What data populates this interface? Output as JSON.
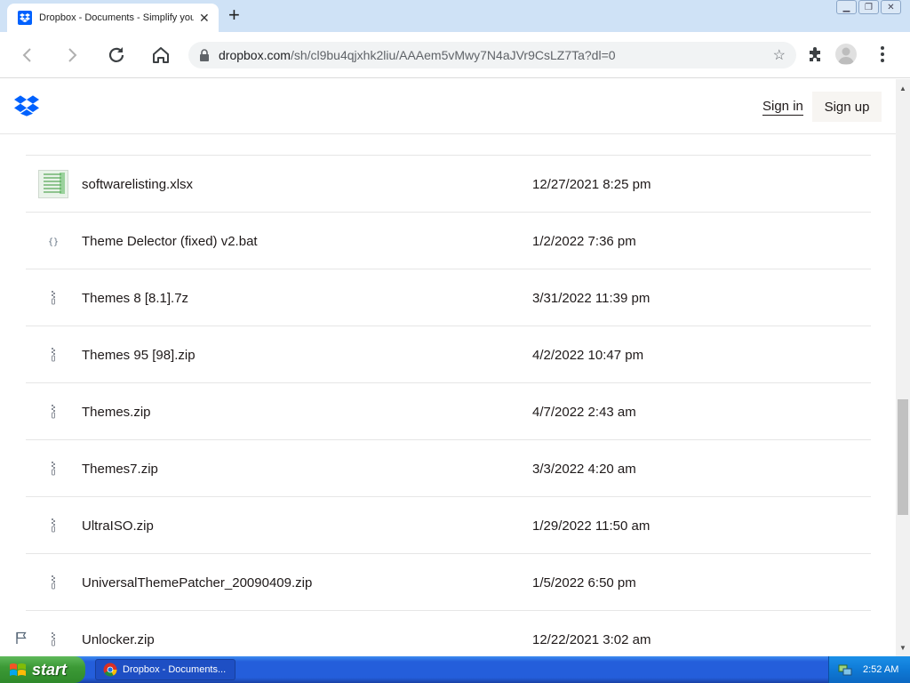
{
  "browser": {
    "tab_title": "Dropbox - Documents - Simplify your",
    "url_host": "dropbox.com",
    "url_path": "/sh/cl9bu4qjxhk2liu/AAAem5vMwy7N4aJVr9CsLZ7Ta?dl=0"
  },
  "header": {
    "signin_label": "Sign in",
    "signup_label": "Sign up"
  },
  "files": [
    {
      "name": "softwarelisting.xlsx",
      "date": "12/27/2021 8:25 pm",
      "icon": "spreadsheet-thumbnail-icon"
    },
    {
      "name": "Theme Delector (fixed) v2.bat",
      "date": "1/2/2022 7:36 pm",
      "icon": "code-file-icon"
    },
    {
      "name": "Themes 8 [8.1].7z",
      "date": "3/31/2022 11:39 pm",
      "icon": "zip-file-icon"
    },
    {
      "name": "Themes 95 [98].zip",
      "date": "4/2/2022 10:47 pm",
      "icon": "zip-file-icon"
    },
    {
      "name": "Themes.zip",
      "date": "4/7/2022 2:43 am",
      "icon": "zip-file-icon"
    },
    {
      "name": "Themes7.zip",
      "date": "3/3/2022 4:20 am",
      "icon": "zip-file-icon"
    },
    {
      "name": "UltraISO.zip",
      "date": "1/29/2022 11:50 am",
      "icon": "zip-file-icon"
    },
    {
      "name": "UniversalThemePatcher_20090409.zip",
      "date": "1/5/2022 6:50 pm",
      "icon": "zip-file-icon"
    },
    {
      "name": "Unlocker.zip",
      "date": "12/22/2021 3:02 am",
      "icon": "zip-file-icon"
    }
  ],
  "taskbar": {
    "start_label": "start",
    "task_label": "Dropbox - Documents...",
    "clock": "2:52 AM"
  },
  "colors": {
    "dropbox_blue": "#0061fe",
    "xp_taskbar": "#245edb",
    "xp_start": "#3c9a36"
  }
}
